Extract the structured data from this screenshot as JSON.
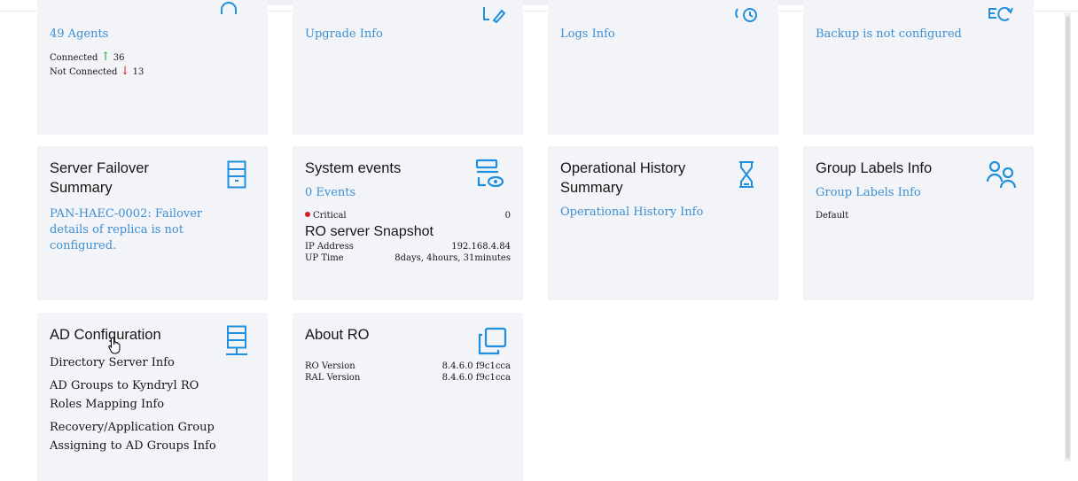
{
  "agents_tile": {
    "link": "49 Agents",
    "connected_label": "Connected",
    "connected_count": "36",
    "not_connected_label": "Not Connected",
    "not_connected_count": "13",
    "arrow_up": "↑",
    "arrow_down": "↓"
  },
  "upgrade_tile": {
    "link": "Upgrade Info"
  },
  "logs_tile": {
    "link": "Logs Info"
  },
  "backup_tile": {
    "link": "Backup is not configured"
  },
  "failover_tile": {
    "title": "Server Failover Summary",
    "link": "PAN-HAEC-0002: Failover details of replica is not configured."
  },
  "events_tile": {
    "title": "System events",
    "link": "0 Events",
    "critical_label": "Critical",
    "critical_count": "0",
    "snapshot_title": "RO server Snapshot",
    "ip_label": "IP Address",
    "ip_value": "192.168.4.84",
    "uptime_label": "UP Time",
    "uptime_value": "8days, 4hours, 31minutes"
  },
  "history_tile": {
    "title": "Operational History Summary",
    "link": "Operational History Info"
  },
  "grouplabels_tile": {
    "title": "Group Labels Info",
    "link": "Group Labels Info",
    "item": "Default"
  },
  "ad_tile": {
    "title": "AD Configuration",
    "items": [
      "Directory Server Info",
      "AD Groups to Kyndryl RO Roles Mapping Info",
      "Recovery/Application Group Assigning to AD Groups Info"
    ]
  },
  "about_tile": {
    "title": "About RO",
    "ro_version_label": "RO Version",
    "ro_version_value": "8.4.6.0 f9c1cca",
    "ral_version_label": "RAL Version",
    "ral_version_value": "8.4.6.0 f9c1cca"
  },
  "colors": {
    "accent": "#1f8fe0",
    "link": "#3d8fd1",
    "tile_bg": "#f2f4f8",
    "up": "#24a148",
    "down": "#da1e28"
  }
}
